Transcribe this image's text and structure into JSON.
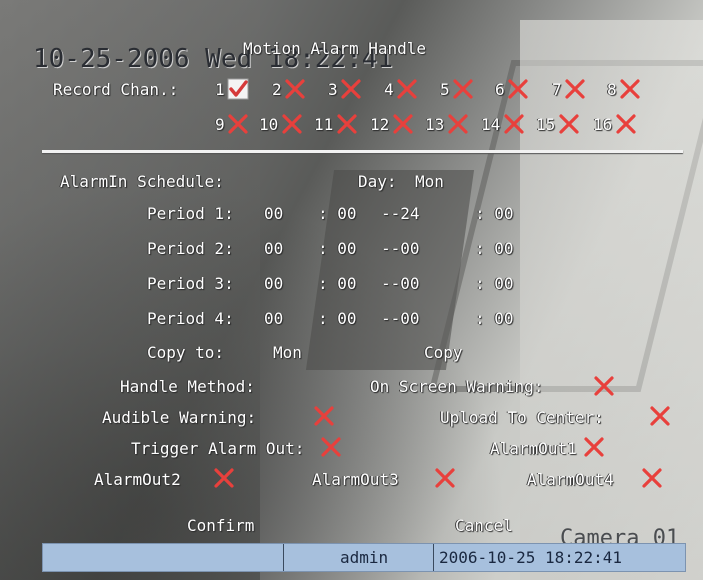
{
  "overlay": {
    "clock": "10-25-2006 Wed 18:22:41",
    "camera_name": "Camera 01"
  },
  "dialog": {
    "title": "Motion Alarm Handle"
  },
  "record_channels": {
    "label": "Record Chan.:",
    "channels": [
      {
        "num": "1",
        "checked": true
      },
      {
        "num": "2",
        "checked": false
      },
      {
        "num": "3",
        "checked": false
      },
      {
        "num": "4",
        "checked": false
      },
      {
        "num": "5",
        "checked": false
      },
      {
        "num": "6",
        "checked": false
      },
      {
        "num": "7",
        "checked": false
      },
      {
        "num": "8",
        "checked": false
      },
      {
        "num": "9",
        "checked": false
      },
      {
        "num": "10",
        "checked": false
      },
      {
        "num": "11",
        "checked": false
      },
      {
        "num": "12",
        "checked": false
      },
      {
        "num": "13",
        "checked": false
      },
      {
        "num": "14",
        "checked": false
      },
      {
        "num": "15",
        "checked": false
      },
      {
        "num": "16",
        "checked": false
      }
    ]
  },
  "schedule": {
    "label": "AlarmIn Schedule:",
    "day_label": "Day:",
    "day_value": "Mon",
    "periods": [
      {
        "label": "Period 1:",
        "start_h": "00",
        "start_m": ": 00",
        "end_h": "--24",
        "end_m": ": 00"
      },
      {
        "label": "Period 2:",
        "start_h": "00",
        "start_m": ": 00",
        "end_h": "--00",
        "end_m": ": 00"
      },
      {
        "label": "Period 3:",
        "start_h": "00",
        "start_m": ": 00",
        "end_h": "--00",
        "end_m": ": 00"
      },
      {
        "label": "Period 4:",
        "start_h": "00",
        "start_m": ": 00",
        "end_h": "--00",
        "end_m": ": 00"
      }
    ],
    "copy_to_label": "Copy to:",
    "copy_to_value": "Mon",
    "copy_button": "Copy"
  },
  "handle": {
    "method_label": "Handle Method:",
    "on_screen_warning": "On Screen Warning:",
    "audible_warning": "Audible Warning:",
    "upload_to_center": "Upload To Center:",
    "trigger_alarm_out": "Trigger Alarm Out:",
    "alarm_outs": [
      "AlarmOut1",
      "AlarmOut2",
      "AlarmOut3",
      "AlarmOut4"
    ]
  },
  "actions": {
    "confirm": "Confirm",
    "cancel": "Cancel"
  },
  "statusbar": {
    "user": "admin",
    "datetime": "2006-10-25 18:22:41"
  },
  "colors": {
    "cross": "#e8403c",
    "check_box": "#f4f4f4",
    "check_mark": "#d63a3a",
    "statusbar_bg": "#a7c0dd"
  }
}
